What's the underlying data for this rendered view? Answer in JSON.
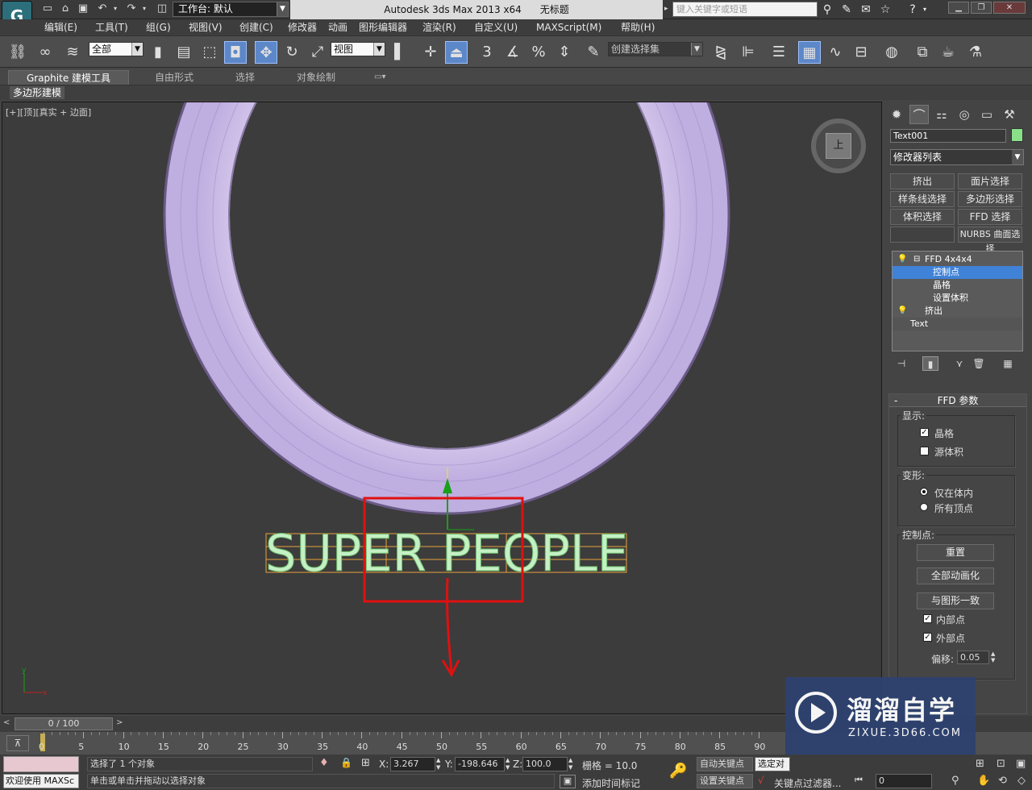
{
  "title_bar": {
    "workspace_label": "工作台: 默认",
    "app_title": "Autodesk 3ds Max  2013 x64",
    "doc_title": "无标题",
    "search_placeholder": "键入关键字或短语"
  },
  "menu": [
    "编辑(E)",
    "工具(T)",
    "组(G)",
    "视图(V)",
    "创建(C)",
    "修改器",
    "动画",
    "图形编辑器",
    "渲染(R)",
    "自定义(U)",
    "MAXScript(M)",
    "帮助(H)"
  ],
  "toolbar": {
    "selection_filter": "全部",
    "ref_coord": "视图",
    "snaps_label": "3",
    "named_selection_placeholder": "创建选择集"
  },
  "ribbon": {
    "tabs": [
      "Graphite 建模工具",
      "自由形式",
      "选择",
      "对象绘制"
    ],
    "sub_label": "多边形建模"
  },
  "viewport": {
    "label": "[+][顶][真实 + 边面]",
    "text_object": "SUPER PEOPLE",
    "viewcube_label": "上",
    "gizmo_x": "x",
    "gizmo_y": "y"
  },
  "command_panel": {
    "object_name": "Text001",
    "object_color": "#88e088",
    "modifier_list": "修改器列表",
    "buttons": [
      "挤出",
      "面片选择",
      "样条线选择",
      "多边形选择",
      "体积选择",
      "FFD 选择",
      "",
      "NURBS 曲面选择"
    ],
    "stack": {
      "ffd": "FFD 4x4x4",
      "sub1": "控制点",
      "sub2": "晶格",
      "sub3": "设置体积",
      "extrude": "挤出",
      "text": "Text"
    }
  },
  "ffd_params": {
    "title": "FFD 参数",
    "rollout_toggle": "-",
    "display_label": "显示:",
    "lattice": "晶格",
    "lattice_checked": true,
    "source_volume": "源体积",
    "source_volume_checked": false,
    "deform_label": "变形:",
    "only_in_volume": "仅在体内",
    "all_vertices": "所有顶点",
    "control_points_label": "控制点:",
    "reset": "重置",
    "animate_all": "全部动画化",
    "conform_to_shape": "与图形一致",
    "inside_points": "内部点",
    "inside_checked": true,
    "outside_points": "外部点",
    "outside_checked": true,
    "offset_label": "偏移:",
    "offset_value": "0.05"
  },
  "timeline": {
    "frame_indicator": "0 / 100",
    "ticks": [
      "0",
      "5",
      "10",
      "15",
      "20",
      "25",
      "30",
      "35",
      "40",
      "45",
      "50",
      "55",
      "60",
      "65",
      "70",
      "75",
      "80",
      "85",
      "90"
    ]
  },
  "status": {
    "welcome": "欢迎使用 MAXSc",
    "selection_info": "选择了 1 个对象",
    "prompt": "单击或单击并拖动以选择对象",
    "x_label": "X:",
    "x_value": "3.267",
    "y_label": "Y:",
    "y_value": "-198.646",
    "z_label": "Z:",
    "z_value": "100.0",
    "grid": "栅格 = 10.0",
    "auto_key": "自动关键点",
    "selected": "选定对",
    "set_key": "设置关键点",
    "key_filters": "关键点过滤器...",
    "add_time_tag": "添加时间标记",
    "frame_field": "0"
  },
  "watermark": {
    "brand": "溜溜自学",
    "url": "ZIXUE.3D66.COM"
  }
}
